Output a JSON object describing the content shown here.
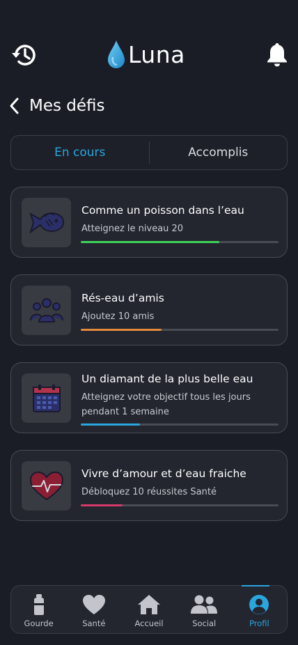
{
  "app": {
    "name": "Luna"
  },
  "header": {
    "history_icon": "history-icon",
    "bell_icon": "bell-icon",
    "logo_icon": "water-drop-icon"
  },
  "page": {
    "title": "Mes défis",
    "back_icon": "chevron-left-icon"
  },
  "tabs": [
    {
      "label": "En cours",
      "active": true
    },
    {
      "label": "Accomplis",
      "active": false
    }
  ],
  "challenges": [
    {
      "title": "Comme un poisson dans l’eau",
      "subtitle": "Atteignez le niveau 20",
      "progress": 0.7,
      "color": "#3fd35b",
      "icon": "fish-icon"
    },
    {
      "title": "Rés-eau d’amis",
      "subtitle": "Ajoutez 10 amis",
      "progress": 0.41,
      "color": "#e38b3a",
      "icon": "friends-group-icon"
    },
    {
      "title": "Un diamant de la plus belle eau",
      "subtitle": "Atteignez votre objectif tous les jours pendant 1 semaine",
      "progress": 0.3,
      "color": "#2aa6dd",
      "icon": "calendar-icon"
    },
    {
      "title": "Vivre d’amour et d’eau fraiche",
      "subtitle": "Débloquez 10 réussites Santé",
      "progress": 0.21,
      "color": "#d43a6a",
      "icon": "heart-pulse-icon"
    }
  ],
  "nav": [
    {
      "label": "Gourde",
      "icon": "bottle-icon",
      "active": false
    },
    {
      "label": "Santé",
      "icon": "heart-icon",
      "active": false
    },
    {
      "label": "Accueil",
      "icon": "home-icon",
      "active": false
    },
    {
      "label": "Social",
      "icon": "users-icon",
      "active": false
    },
    {
      "label": "Profil",
      "icon": "profile-icon",
      "active": true
    }
  ],
  "colors": {
    "accent": "#2aa6dd",
    "background": "#1b1d26",
    "card": "#23252f"
  }
}
